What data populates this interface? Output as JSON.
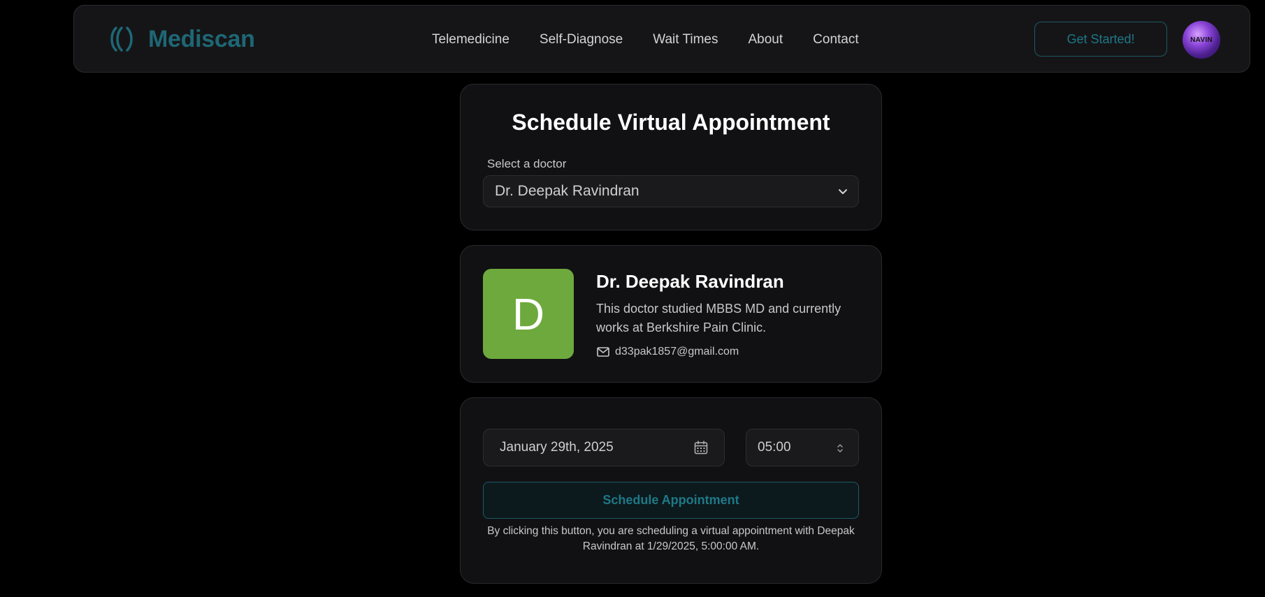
{
  "nav": {
    "brand": "Mediscan",
    "links": [
      {
        "label": "Telemedicine"
      },
      {
        "label": "Self-Diagnose"
      },
      {
        "label": "Wait Times"
      },
      {
        "label": "About"
      },
      {
        "label": "Contact"
      }
    ],
    "cta_label": "Get Started!",
    "avatar_text": "NAVIN",
    "brand_color": "#1e6775"
  },
  "appointment": {
    "title": "Schedule Virtual Appointment",
    "select_label": "Select a doctor",
    "selected_doctor": "Dr. Deepak Ravindran"
  },
  "doctor": {
    "initial": "D",
    "name": "Dr. Deepak Ravindran",
    "description": "This doctor studied MBBS MD and currently works at Berkshire Pain Clinic.",
    "email": "d33pak1857@gmail.com",
    "avatar_color": "#6ea93d"
  },
  "booking": {
    "date": "January 29th, 2025",
    "time": "05:00",
    "button_label": "Schedule Appointment",
    "disclaimer": "By clicking this button, you are scheduling a virtual appointment with Deepak Ravindran at 1/29/2025, 5:00:00 AM."
  },
  "icons": {
    "logo": "logo-icon",
    "chevron": "chevron-down-icon",
    "mail": "mail-icon",
    "calendar": "calendar-icon",
    "stepper": "up-down-icon"
  }
}
